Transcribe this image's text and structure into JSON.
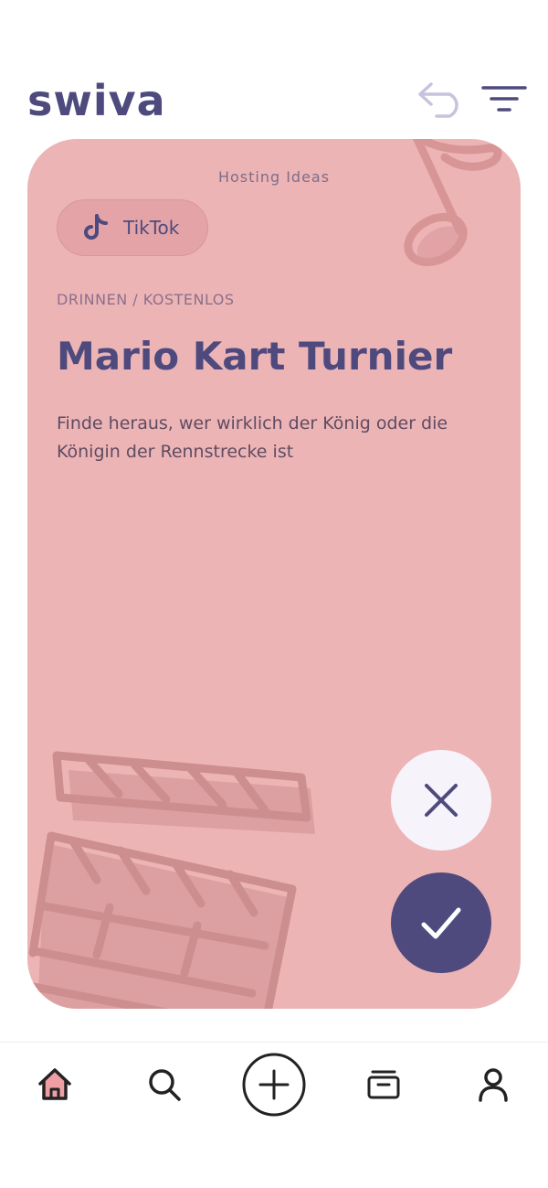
{
  "header": {
    "logo_text": "swiva",
    "undo_icon": "undo-arrow-icon",
    "filter_icon": "filter-lines-icon"
  },
  "card": {
    "heading": "Hosting Ideas",
    "chip": {
      "icon": "tiktok-icon",
      "label": "TikTok"
    },
    "category": "DRINNEN / KOSTENLOS",
    "title": "Mario Kart Turnier",
    "description": "Finde heraus, wer wirklich der König oder die Königin der Rennstrecke ist",
    "decorations": [
      "music-note-icon",
      "film-clapper-icon"
    ]
  },
  "actions": {
    "reject_icon": "close-icon",
    "accept_icon": "check-icon"
  },
  "bottom_nav": {
    "items": [
      "home-icon",
      "search-icon",
      "add-circle-icon",
      "collections-icon",
      "profile-icon"
    ],
    "active": "home-icon"
  },
  "colors": {
    "brand": "#4e4a7e",
    "card": "#edb4b6",
    "accent_pink": "#ef9fa4"
  }
}
